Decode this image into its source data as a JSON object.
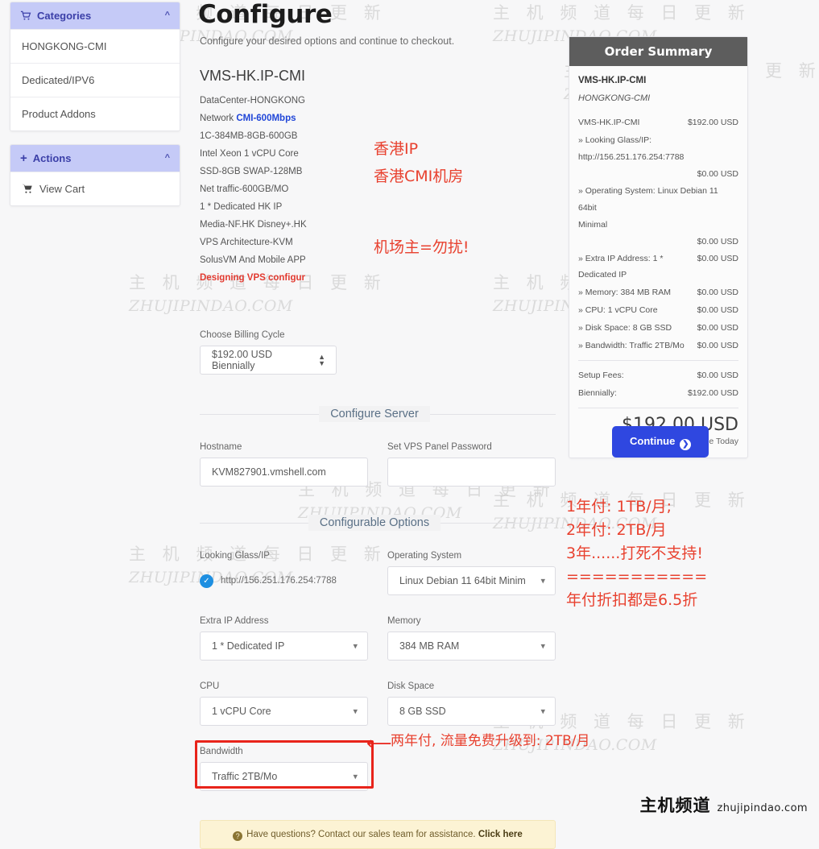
{
  "sidebar": {
    "categories": {
      "title": "Categories",
      "icon": "cart-icon",
      "collapse_icon": "chevron-up-icon",
      "items": [
        {
          "label": "HONGKONG-CMI"
        },
        {
          "label": "Dedicated/IPV6"
        },
        {
          "label": "Product Addons"
        }
      ]
    },
    "actions": {
      "title": "Actions",
      "icon": "plus-icon",
      "collapse_icon": "chevron-up-icon",
      "items": [
        {
          "label": "View Cart",
          "icon": "cart-icon"
        }
      ]
    }
  },
  "header": {
    "title": "Configure",
    "subtitle": "Configure your desired options and continue to checkout."
  },
  "product": {
    "name": "VMS-HK.IP-CMI",
    "specs": [
      "DataCenter-HONGKONG",
      "1C-384MB-8GB-600GB",
      "Intel Xeon 1 vCPU Core",
      "SSD-8GB SWAP-128MB",
      "Net traffic-600GB/MO",
      "1 * Dedicated HK IP",
      "Media-NF.HK Disney+.HK",
      "VPS Architecture-KVM",
      "SolusVM And Mobile APP"
    ],
    "network_label": "Network ",
    "network_value": "CMI-600Mbps",
    "footer_note": "Designing VPS configur"
  },
  "billing": {
    "label": "Choose Billing Cycle",
    "value": "$192.00 USD Biennially",
    "stepper_icon": "up-down-icon"
  },
  "configure_server": {
    "section_title": "Configure Server",
    "hostname_label": "Hostname",
    "hostname_value": "KVM827901.vmshell.com",
    "password_label": "Set VPS Panel Password",
    "password_value": "",
    "password_placeholder": ""
  },
  "configurable_options": {
    "section_title": "Configurable Options",
    "looking_glass": {
      "label": "Looking Glass/IP",
      "value": "http://156.251.176.254:7788",
      "checked_icon": "check-circle-icon"
    },
    "operating_system": {
      "label": "Operating System",
      "value": "Linux Debian 11 64bit Minim"
    },
    "extra_ip": {
      "label": "Extra IP Address",
      "value": "1 * Dedicated IP"
    },
    "memory": {
      "label": "Memory",
      "value": "384 MB RAM"
    },
    "cpu": {
      "label": "CPU",
      "value": "1 vCPU Core"
    },
    "disk_space": {
      "label": "Disk Space",
      "value": "8 GB SSD"
    },
    "bandwidth": {
      "label": "Bandwidth",
      "value": "Traffic 2TB/Mo",
      "highlight_color": "#e8241b"
    },
    "caret_icon": "chevron-down-icon"
  },
  "notice": {
    "icon": "question-circle-icon",
    "text": "Have questions? Contact our sales team for assistance. ",
    "link": "Click here"
  },
  "order_summary": {
    "title": "Order Summary",
    "product": "VMS-HK.IP-CMI",
    "datacenter": "HONGKONG-CMI",
    "base_line_label": "VMS-HK.IP-CMI",
    "base_line_amount": "$192.00 USD",
    "looking_glass_label": "» Looking Glass/IP:",
    "looking_glass_value": "http://156.251.176.254:7788",
    "looking_glass_amount": "$0.00 USD",
    "os_label": "» Operating System: Linux Debian 11 64bit",
    "os_label2": "Minimal",
    "os_amount": "$0.00 USD",
    "rows": [
      {
        "label": "» Extra IP Address: 1 * Dedicated IP",
        "amount": "$0.00 USD"
      },
      {
        "label": "» Memory: 384 MB RAM",
        "amount": "$0.00 USD"
      },
      {
        "label": "» CPU: 1 vCPU Core",
        "amount": "$0.00 USD"
      },
      {
        "label": "» Disk Space: 8 GB SSD",
        "amount": "$0.00 USD"
      },
      {
        "label": "» Bandwidth: Traffic 2TB/Mo",
        "amount": "$0.00 USD"
      }
    ],
    "setup_fees_label": "Setup Fees:",
    "setup_fees_amount": "$0.00 USD",
    "cycle_label": "Biennially:",
    "cycle_amount": "$192.00 USD",
    "total": "$192.00 USD",
    "total_note": "Total Due Today"
  },
  "continue": {
    "label": "Continue",
    "icon": "arrow-right-circle-icon",
    "color": "#2f47e0"
  },
  "annotations": {
    "color": "#e8412f",
    "location": "香港IP\n香港CMI机房",
    "no_disturb": "机场主=勿扰!",
    "pricing": "1年付: 1TB/月;\n2年付: 2TB/月\n3年......打死不支持!\n===========\n年付折扣都是6.5折",
    "bandwidth_note": "两年付, 流量免费升级到: 2TB/月",
    "arrow_icon": "left-arrow-icon"
  },
  "watermark": {
    "cn": "主 机 频 道  每 日 更 新",
    "en": "ZHUJIPINDAO.COM"
  },
  "brand": {
    "cn": "主机频道",
    "en": "zhujipindao.com"
  }
}
